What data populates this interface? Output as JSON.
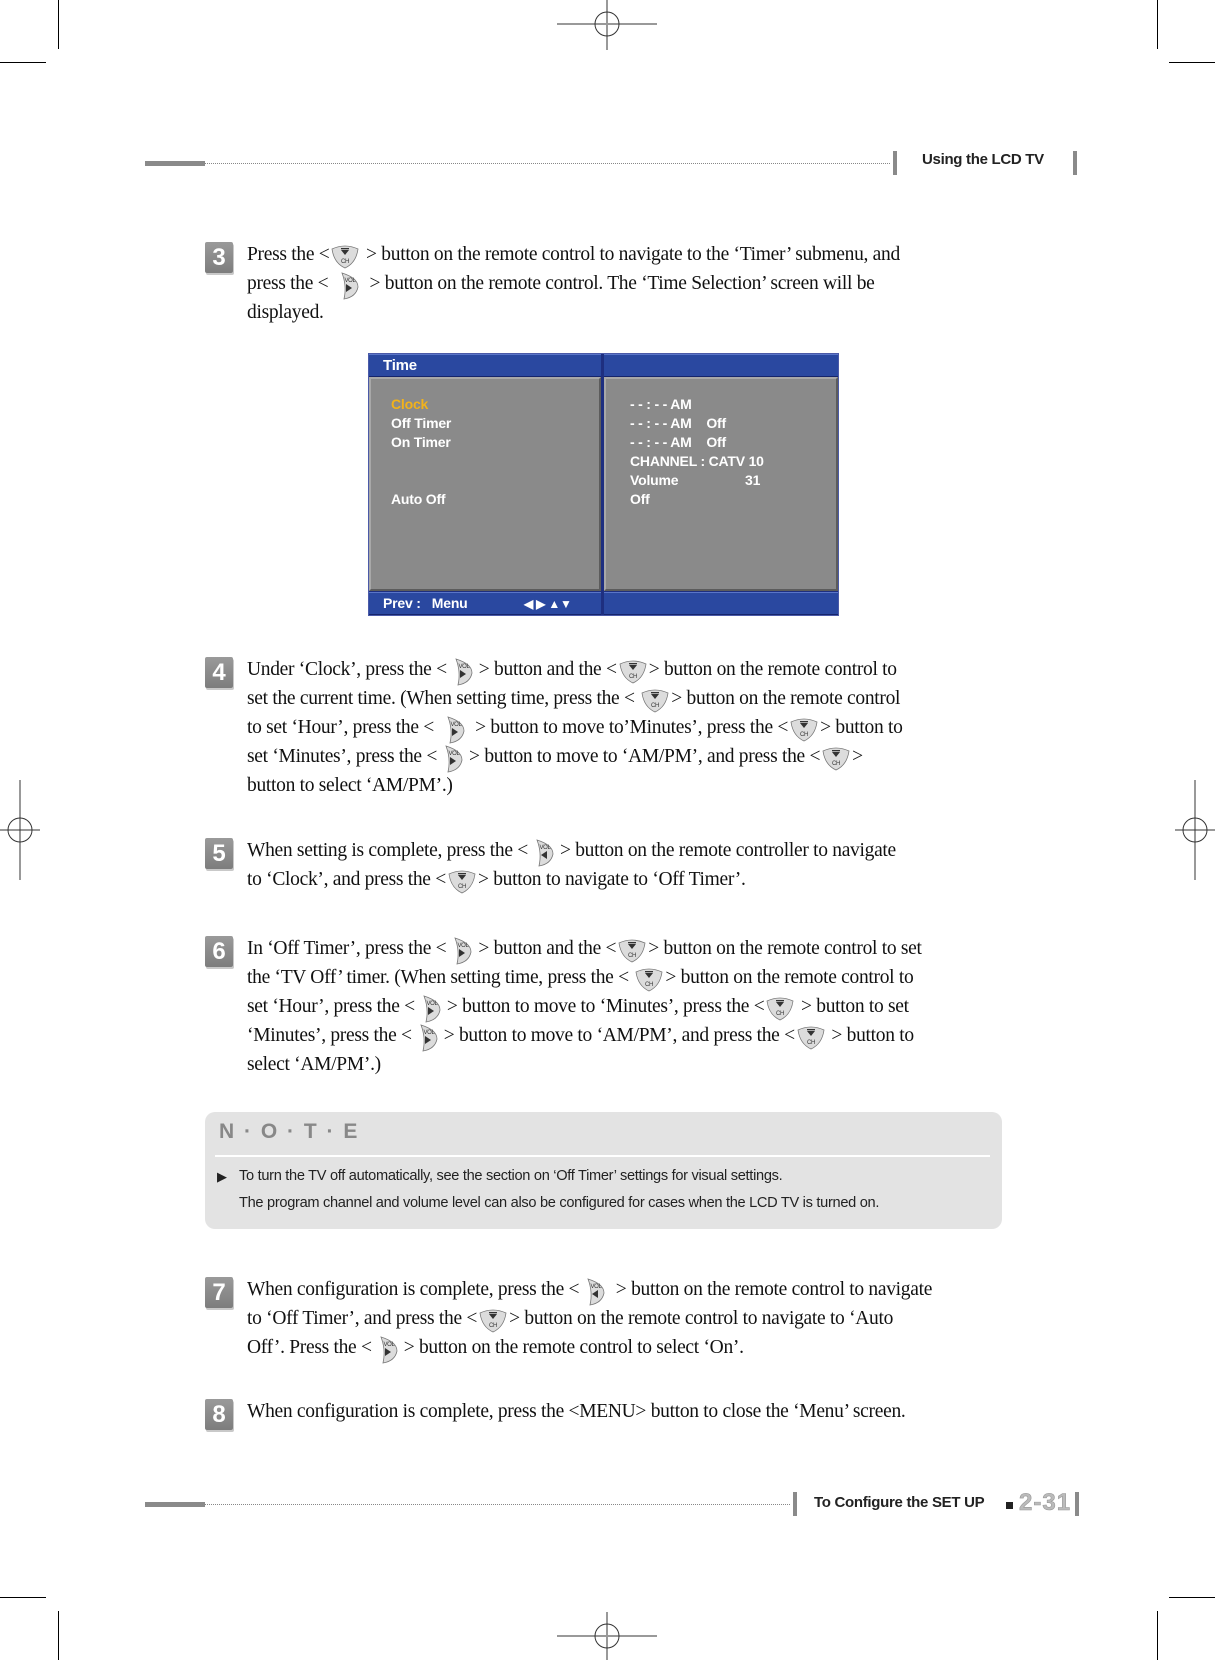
{
  "header": {
    "section_title": "Using the LCD TV"
  },
  "footer": {
    "chapter_title": "To Configure the SET UP",
    "page_number": "2-31"
  },
  "steps": [
    {
      "number": "3",
      "parts": [
        "Press the <",
        {
          "icon": "ch-down"
        },
        " > button on the remote control to navigate to the ‘Timer’ submenu, and",
        "\n",
        "press the < ",
        {
          "icon": "vol-right"
        },
        " > button on the remote control. The ‘Time Selection’ screen will be",
        "\n",
        "displayed."
      ]
    },
    {
      "number": "4",
      "parts": [
        "Under ‘Clock’, press the <",
        {
          "icon": "vol-right"
        },
        "> button and the <",
        {
          "icon": "ch-down"
        },
        "> button on the remote control to",
        "\n",
        "set the current time. (When setting time, press the < ",
        {
          "icon": "ch-down"
        },
        "> button on the remote control",
        "\n",
        "to set ‘Hour’, press the < ",
        {
          "icon": "vol-right"
        },
        " > button to move to’Minutes’, press the <",
        {
          "icon": "ch-down"
        },
        "> button to",
        "\n",
        "set ‘Minutes’, press the <",
        {
          "icon": "vol-right"
        },
        "> button to move to ‘AM/PM’, and press the <",
        {
          "icon": "ch-down"
        },
        ">",
        "\n",
        "button to select ‘AM/PM’.)"
      ]
    },
    {
      "number": "5",
      "parts": [
        "When setting is complete, press the <",
        {
          "icon": "vol-left"
        },
        "> button on the remote controller to navigate",
        "\n",
        "to ‘Clock’, and press the <",
        {
          "icon": "ch-down"
        },
        "> button to navigate to ‘Off Timer’."
      ]
    },
    {
      "number": "6",
      "parts": [
        "In ‘Off Timer’, press the <",
        {
          "icon": "vol-right"
        },
        "> button and the <",
        {
          "icon": "ch-down"
        },
        "> button on the remote control to set",
        "\n",
        "the ‘TV Off’ timer. (When setting time, press the < ",
        {
          "icon": "ch-down"
        },
        "> button on the remote control to",
        "\n",
        "set ‘Hour’, press the <",
        {
          "icon": "vol-right"
        },
        "> button to move to ‘Minutes’, press the <",
        {
          "icon": "ch-down"
        },
        " > button to set",
        "\n",
        "‘Minutes’, press the <",
        {
          "icon": "vol-right"
        },
        "> button to move to ‘AM/PM’, and press the <",
        {
          "icon": "ch-down"
        },
        " > button to",
        "\n",
        "select ‘AM/PM’.)"
      ]
    },
    {
      "number": "7",
      "parts": [
        "When configuration is complete, press the <",
        {
          "icon": "vol-left"
        },
        " > button on the remote control to navigate",
        "\n",
        "to ‘Off Timer’, and press the <",
        {
          "icon": "ch-down"
        },
        "> button on the remote control to navigate to ‘Auto",
        "\n",
        "Off’. Press the <",
        {
          "icon": "vol-right"
        },
        "> button on the remote control to select ‘On’."
      ]
    },
    {
      "number": "8",
      "parts": [
        "When configuration is complete, press the <MENU> button to close the ‘Menu’ screen."
      ]
    }
  ],
  "osd": {
    "title": "Time",
    "menu_items": [
      {
        "label": "Clock",
        "selected": true
      },
      {
        "label": "Off Timer",
        "selected": false
      },
      {
        "label": "On Timer",
        "selected": false
      },
      {
        "label": "Auto Off",
        "selected": false
      }
    ],
    "values": {
      "clock": "- - : - - AM",
      "off_timer": "- - : - - AM    Off",
      "on_timer": "- - : - - AM    Off",
      "channel": "CHANNEL : CATV 10",
      "volume_label": "Volume",
      "volume_value": "31",
      "auto_off": "Off"
    },
    "footer_prev": "Prev :   Menu",
    "footer_arrows": "◀ ▶ ▲▼",
    "colors": {
      "bar": "#2a48a0",
      "panel": "#8a8a8a",
      "selected": "#f2b21a"
    }
  },
  "note": {
    "title": "N · O · T · E",
    "bullet": "▶",
    "lines": [
      "To turn the TV off automatically, see the section on ‘Off Timer’ settings for visual settings.",
      "The program channel and volume level can also be configured for cases when the LCD TV is turned on."
    ]
  },
  "icons": {
    "ch-down": {
      "label": "CH",
      "semantic": "channel-down-button-icon"
    },
    "vol-right": {
      "label": "VOL",
      "semantic": "volume-right-button-icon"
    },
    "vol-left": {
      "label": "VOL",
      "semantic": "volume-left-button-icon"
    }
  }
}
